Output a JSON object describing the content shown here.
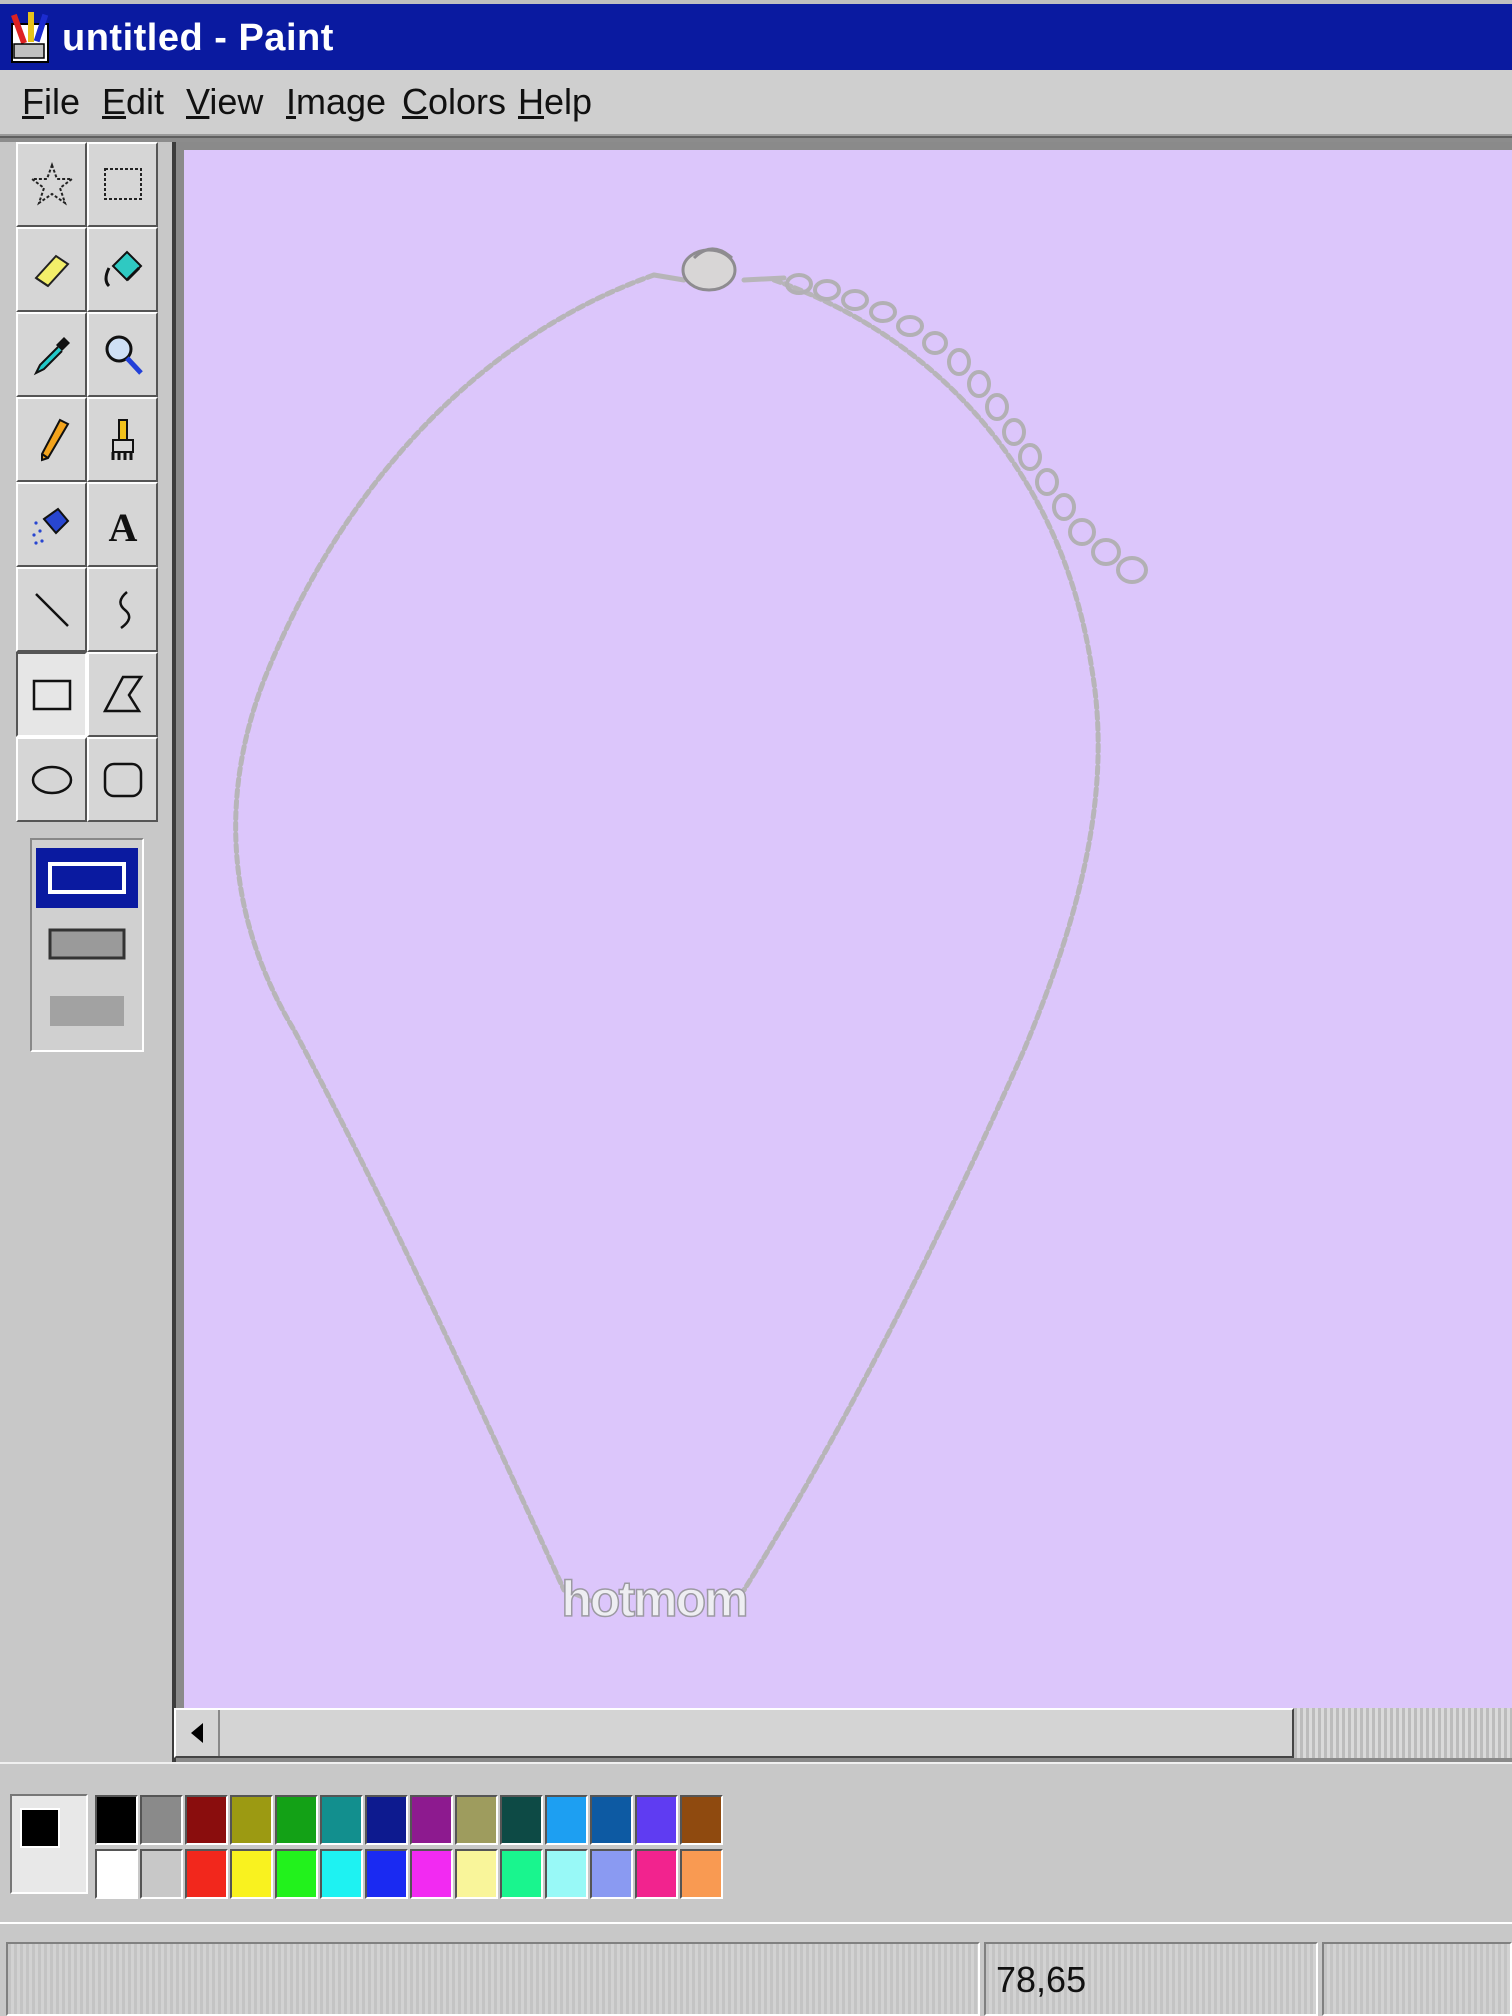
{
  "window": {
    "title": "untitled - Paint"
  },
  "menu": [
    {
      "label_ul": "F",
      "label_rest": "ile"
    },
    {
      "label_ul": "E",
      "label_rest": "dit"
    },
    {
      "label_ul": "V",
      "label_rest": "iew"
    },
    {
      "label_ul": "I",
      "label_rest": "mage"
    },
    {
      "label_ul": "C",
      "label_rest": "olors"
    },
    {
      "label_ul": "H",
      "label_rest": "elp"
    }
  ],
  "tools": [
    {
      "name": "free-form-select",
      "icon": "star-select-icon"
    },
    {
      "name": "select",
      "icon": "rect-select-icon"
    },
    {
      "name": "eraser",
      "icon": "eraser-icon"
    },
    {
      "name": "fill-with-color",
      "icon": "paint-bucket-icon"
    },
    {
      "name": "pick-color",
      "icon": "eyedropper-icon"
    },
    {
      "name": "magnifier",
      "icon": "magnifier-icon"
    },
    {
      "name": "pencil",
      "icon": "pencil-icon"
    },
    {
      "name": "brush",
      "icon": "brush-icon"
    },
    {
      "name": "airbrush",
      "icon": "airbrush-icon"
    },
    {
      "name": "text",
      "icon": "text-icon",
      "glyph": "A"
    },
    {
      "name": "line",
      "icon": "line-icon"
    },
    {
      "name": "curve",
      "icon": "curve-icon"
    },
    {
      "name": "rectangle",
      "icon": "rectangle-icon",
      "selected": true
    },
    {
      "name": "polygon",
      "icon": "polygon-icon"
    },
    {
      "name": "ellipse",
      "icon": "ellipse-icon"
    },
    {
      "name": "rounded-rectangle",
      "icon": "rounded-rectangle-icon"
    }
  ],
  "canvas": {
    "background": "#dcc6fb",
    "pendant_text": "hotmom"
  },
  "palette": {
    "foreground": "#000000",
    "background": "#ffffff",
    "row1": [
      "#000000",
      "#8a8a8a",
      "#8a0d0d",
      "#9c9a12",
      "#13a116",
      "#128f8e",
      "#0d1a8f",
      "#8d1a8f",
      "#9e9c5e",
      "#0d4a45",
      "#1d9ff2",
      "#0d5aa3",
      "#5f3cf2",
      "#8f4a0f"
    ],
    "row2": [
      "#ffffff",
      "#c8c8c8",
      "#f2271c",
      "#f9f21f",
      "#22f21c",
      "#1ef2f2",
      "#1a2af2",
      "#f22af2",
      "#f9f59a",
      "#19f58e",
      "#98f9f7",
      "#8a9af2",
      "#f2238e",
      "#f99a52"
    ]
  },
  "status": {
    "coords": "78,65"
  }
}
